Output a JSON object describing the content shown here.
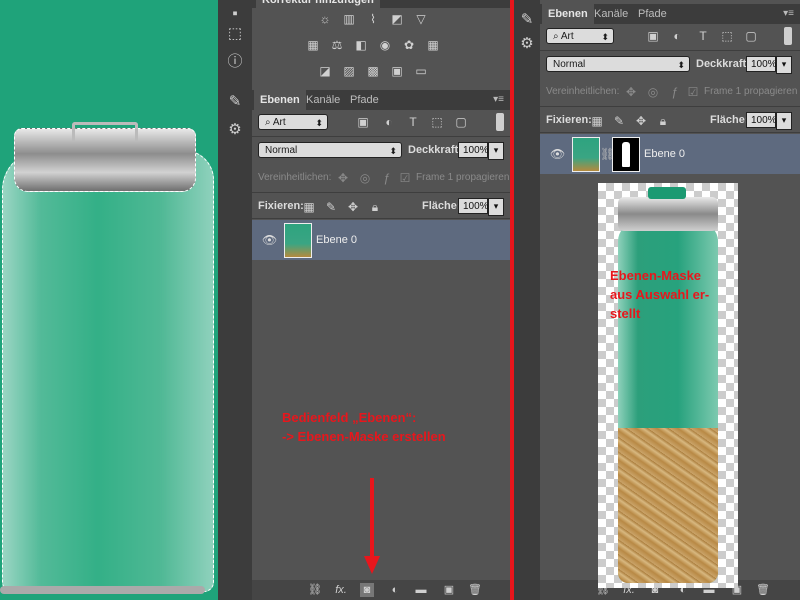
{
  "app": {
    "accent_red": "#e8161c",
    "selection_row_color": "#5e6a7f"
  },
  "corrections_panel": {
    "title": "Korrektur hinzufügen"
  },
  "layers_panel": {
    "tabs": [
      "Ebenen",
      "Kanäle",
      "Pfade"
    ],
    "filter": {
      "value": "Art"
    },
    "blend_mode": "Normal",
    "opacity_label": "Deckkraft:",
    "opacity_value": "100%",
    "unify_label": "Vereinheitlichen:",
    "propagate_label": "Frame 1 propagieren",
    "lock_label": "Fixieren:",
    "fill_label": "Fläche:",
    "fill_value": "100%",
    "layer_name": "Ebene 0"
  },
  "layers_panel_right": {
    "tabs": [
      "Ebenen",
      "Kanäle",
      "Pfade"
    ],
    "filter": {
      "value": "Art"
    },
    "blend_mode": "Normal",
    "opacity_label": "Deckkraft:",
    "opacity_value": "100%",
    "unify_label": "Vereinheitlichen:",
    "propagate_label": "Frame 1 propagieren",
    "lock_label": "Fixieren:",
    "fill_label": "Fläche:",
    "fill_value": "100%",
    "layer_name": "Ebene 0"
  },
  "annotations": {
    "left_line1": "Bedienfeld „Ebenen“:",
    "left_line2": "-> Ebenen-Maske erstellen",
    "right_line1": "Ebenen-Maske",
    "right_line2": "aus Auswahl er-",
    "right_line3": "stellt"
  },
  "icons": {
    "link": "link-icon",
    "fx": "fx",
    "mask": "add-mask-icon",
    "adjust": "adjustment-layer-icon",
    "folder": "group-folder-icon",
    "new": "new-layer-icon",
    "trash": "trash-icon"
  }
}
